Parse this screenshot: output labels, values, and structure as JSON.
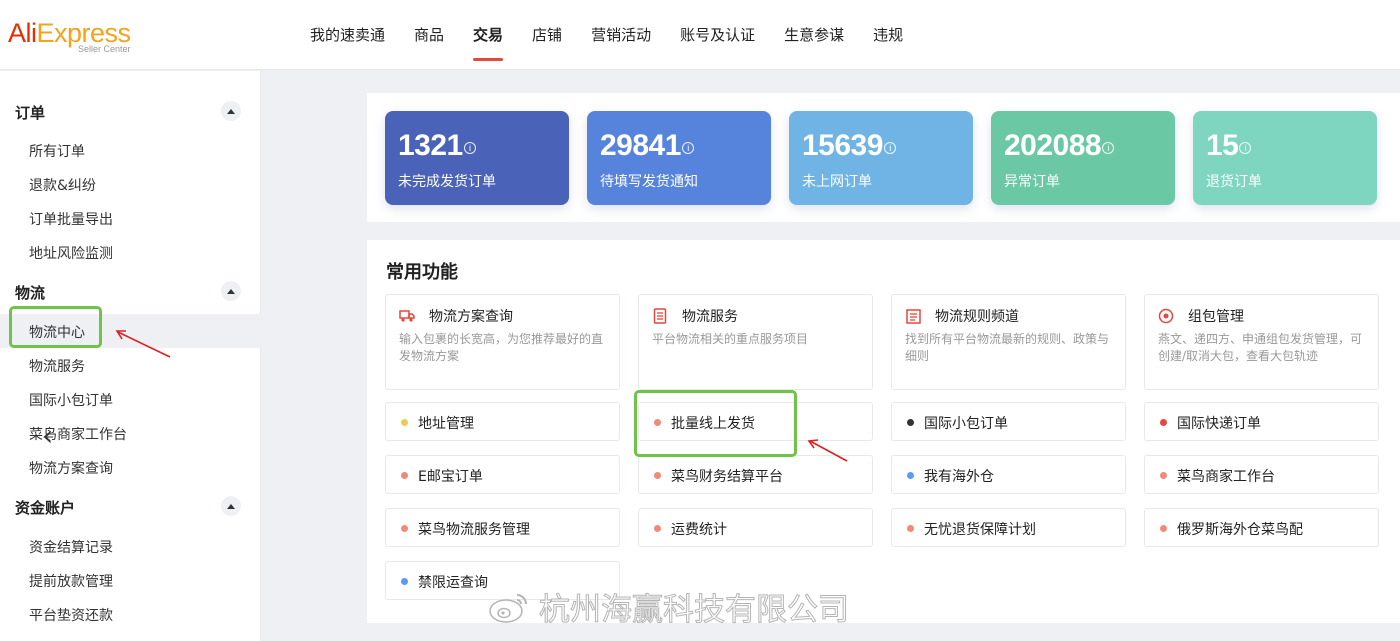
{
  "logo": {
    "brand_ali": "Ali",
    "brand_express": "Express",
    "sub": "Seller Center"
  },
  "nav": [
    "我的速卖通",
    "商品",
    "交易",
    "店铺",
    "营销活动",
    "账号及认证",
    "生意参谋",
    "违规"
  ],
  "sidebar": {
    "groups": [
      {
        "title": "订单",
        "items": [
          "所有订单",
          "退款&纠纷",
          "订单批量导出",
          "地址风险监测"
        ]
      },
      {
        "title": "物流",
        "items": [
          "物流中心",
          "物流服务",
          "国际小包订单",
          "菜鸟商家工作台",
          "物流方案查询"
        ]
      },
      {
        "title": "资金账户",
        "items": [
          "资金结算记录",
          "提前放款管理",
          "平台垫资还款"
        ]
      }
    ]
  },
  "stats": [
    {
      "value": "1321",
      "label": "未完成发货订单",
      "color": "#4a62b8"
    },
    {
      "value": "29841",
      "label": "待填写发货通知",
      "color": "#5683dc"
    },
    {
      "value": "15639",
      "label": "未上网订单",
      "color": "#6fb4e4"
    },
    {
      "value": "202088",
      "label": "异常订单",
      "color": "#6ac8a4"
    },
    {
      "value": "15",
      "label": "退货订单",
      "color": "#7ed5c0"
    }
  ],
  "functions": {
    "title": "常用功能",
    "featured": [
      {
        "title": "物流方案查询",
        "desc": "输入包裹的长宽高，为您推荐最好的直发物流方案",
        "icon": "truck-icon"
      },
      {
        "title": "物流服务",
        "desc": "平台物流相关的重点服务项目",
        "icon": "document-icon"
      },
      {
        "title": "物流规则频道",
        "desc": "找到所有平台物流最新的规则、政策与细则",
        "icon": "list-icon"
      },
      {
        "title": "组包管理",
        "desc": "燕文、递四方、申通组包发货管理，可创建/取消大包，查看大包轨迹",
        "icon": "package-icon"
      }
    ],
    "shortcuts": [
      {
        "label": "地址管理",
        "dot": "#f2c94c"
      },
      {
        "label": "批量线上发货",
        "dot": "#f08a77"
      },
      {
        "label": "国际小包订单",
        "dot": "#333333"
      },
      {
        "label": "国际快递订单",
        "dot": "#e8453c"
      },
      {
        "label": "E邮宝订单",
        "dot": "#f08a77"
      },
      {
        "label": "菜鸟财务结算平台",
        "dot": "#f08a77"
      },
      {
        "label": "我有海外仓",
        "dot": "#5b9bf0"
      },
      {
        "label": "菜鸟商家工作台",
        "dot": "#f08a77"
      },
      {
        "label": "菜鸟物流服务管理",
        "dot": "#f08a77"
      },
      {
        "label": "运费统计",
        "dot": "#f08a77"
      },
      {
        "label": "无忧退货保障计划",
        "dot": "#f08a77"
      },
      {
        "label": "俄罗斯海外仓菜鸟配",
        "dot": "#f08a77"
      },
      {
        "label": "禁限运查询",
        "dot": "#5b9bf0"
      }
    ]
  },
  "watermark": "杭州海赢科技有限公司",
  "colors": {
    "accent_red": "#e8453c",
    "highlight_green": "#6fc24a",
    "annotation_red": "#e02020"
  }
}
